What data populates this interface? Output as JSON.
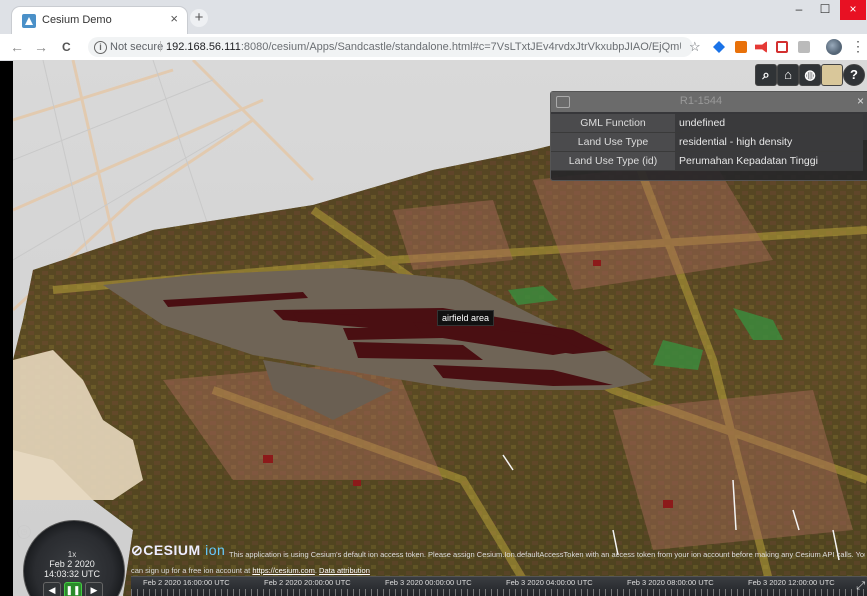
{
  "browser": {
    "tab_title": "Cesium Demo",
    "tab_close": "×",
    "new_tab": "+",
    "window": {
      "minimize": "–",
      "maximize": "☐",
      "close": "×"
    },
    "nav": {
      "back": "←",
      "forward": "→",
      "reload": "C"
    },
    "security_label": "Not secure",
    "url_host": "192.168.56.111",
    "url_rest": ":8080/cesium/Apps/Sandcastle/standalone.html#c=7VsLTxtJEv4rvdxJtrVkxubpJIAO/EjQmU0kkz3dAYraM22...",
    "star": "☆",
    "menu": "⋮"
  },
  "toolbar": {
    "search_icon": "search-icon",
    "home_icon": "home-icon",
    "globe_icon": "globe-icon",
    "layers_icon": "base-layer-picker-icon",
    "help_label": "?"
  },
  "infobox": {
    "title": "R1-1544",
    "close": "×",
    "rows": [
      {
        "key": "GML Function",
        "value": "undefined"
      },
      {
        "key": "Land Use Type",
        "value": "residential - high density"
      },
      {
        "key": "Land Use Type (id)",
        "value": "Perumahan Kepadatan Tinggi"
      }
    ]
  },
  "map_label": "airfield area",
  "animation": {
    "speed": "1x",
    "date": "Feb 2 2020",
    "time": "14:03:32 UTC",
    "clock_icon": "◷"
  },
  "credits": {
    "logo": "CESIUM",
    "logo_ion": "ion",
    "line1": "This application is using Cesium's default ion access token. Please assign Cesium.Ion.defaultAccessToken with an access token from your ion account before making any Cesium API calls. You",
    "line2_prefix": "can sign up for a free ion account at ",
    "line2_link": "https://cesium.com",
    "line2_sep": ". ",
    "line2_attr": "Data attribution"
  },
  "timeline": {
    "labels": [
      "Feb 2 2020 16:00:00 UTC",
      "Feb 2 2020 20:00:00 UTC",
      "Feb 3 2020 00:00:00 UTC",
      "Feb 3 2020 04:00:00 UTC",
      "Feb 3 2020 08:00:00 UTC",
      "Feb 3 2020 12:00:00 UTC"
    ]
  }
}
